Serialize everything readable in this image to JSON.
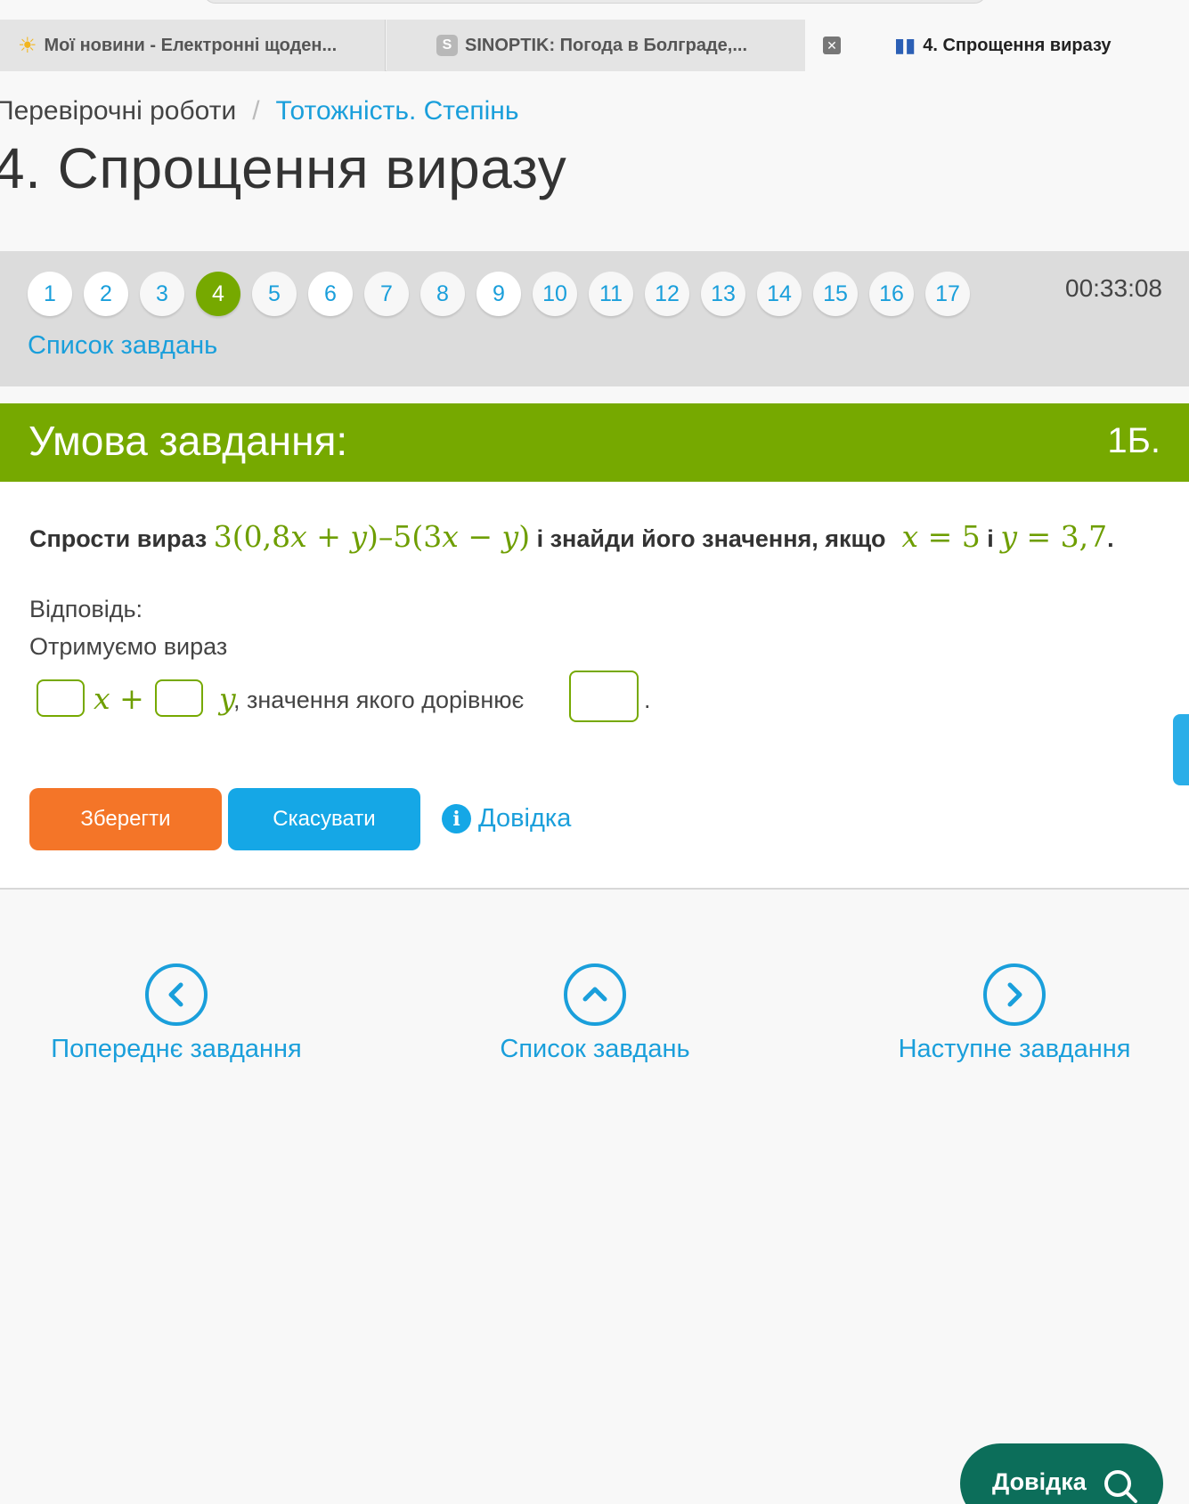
{
  "browser": {
    "tabs": [
      {
        "label": "Мої новини - Електронні щоден...",
        "icon": "sun-icon"
      },
      {
        "label": "SINOPTIK: Погода в Болграде,...",
        "icon": "s-favicon-icon"
      },
      {
        "label": "4. Спрощення виразу",
        "icon": "book-icon"
      }
    ]
  },
  "breadcrumb": {
    "parent": "Перевірочні роботи",
    "separator": "/",
    "current": "Тотожність. Степінь"
  },
  "page_title": "4. Спрощення виразу",
  "task_nav": {
    "numbers": [
      "1",
      "2",
      "3",
      "4",
      "5",
      "6",
      "7",
      "8",
      "9",
      "10",
      "11",
      "12",
      "13",
      "14",
      "15",
      "16",
      "17"
    ],
    "active": "4",
    "done": [
      "1",
      "2",
      "6",
      "9"
    ],
    "timer": "00:33:08",
    "task_list_label": "Список завдань"
  },
  "condition": {
    "title": "Умова завдання:",
    "points": "1Б.",
    "question_prefix": "Спрости вираз",
    "question_mid": "і знайди його значення, якщо",
    "question_and": "і",
    "expr": {
      "a1": "3(0,8",
      "v1": "x",
      "a2": " + ",
      "v2": "y",
      "a3": ")–5(3",
      "v3": "x",
      "a4": " − ",
      "v4": "y",
      "a5": ")"
    },
    "cond_x": {
      "v": "x",
      "rest": " = 5"
    },
    "cond_y": {
      "v": "y",
      "rest": " = 3,7"
    },
    "question_end": "."
  },
  "answer": {
    "label": "Відповідь:",
    "intro": "Отримуємо вираз",
    "var_x": "x",
    "plus": " + ",
    "var_y": "y",
    "value_text": ", значення якого дорівнює",
    "end": ".",
    "box1_value": "",
    "box2_value": "",
    "box3_value": ""
  },
  "buttons": {
    "save": "Зберегти",
    "cancel": "Скасувати",
    "help": "Довідка"
  },
  "bottom_nav": {
    "prev": "Попереднє завдання",
    "list": "Список завдань",
    "next": "Наступне завдання"
  },
  "help_fab": "Довідка",
  "colors": {
    "accent_green": "#76a900",
    "link_blue": "#1a9fdb",
    "save_orange": "#f47528",
    "cancel_blue": "#15a7e6",
    "fab_teal": "#0c6e5a"
  }
}
